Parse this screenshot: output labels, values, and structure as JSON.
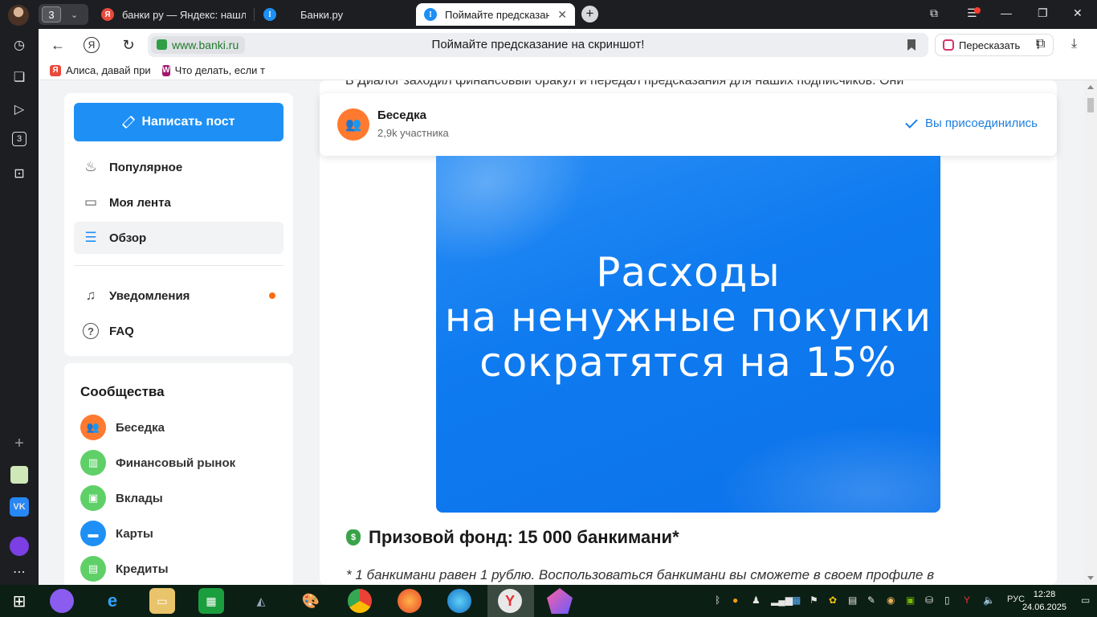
{
  "browser": {
    "tab_count": "3",
    "tabs": [
      {
        "label": "банки ру — Яндекс: нашл",
        "fav_color": "#e84a3c",
        "fav_glyph": "Я"
      },
      {
        "label": "Банки.ру",
        "fav_color": "#1e90f5",
        "fav_glyph": "⁝"
      },
      {
        "label": "Поймайте предсказани",
        "fav_color": "#1e90f5",
        "fav_glyph": "⁝"
      }
    ],
    "domain": "www.banki.ru",
    "page_title": "Поймайте предсказание на скриншот!",
    "retell_label": "Пересказать",
    "bookmarks": [
      {
        "label": "Алиса, давай при",
        "icon_color": "#e84a3c",
        "glyph": "Я"
      },
      {
        "label": "Что делать, если т",
        "icon_color": "#a3166e",
        "glyph": "W"
      }
    ],
    "rail_tab_count": "3"
  },
  "sidebar": {
    "write_post_label": "Написать пост",
    "nav": [
      {
        "label": "Популярное",
        "icon": "flame-icon",
        "glyph": "♨"
      },
      {
        "label": "Моя лента",
        "icon": "feed-icon",
        "glyph": "▭"
      },
      {
        "label": "Обзор",
        "icon": "explore-icon",
        "glyph": "☰"
      },
      {
        "label": "Уведомления",
        "icon": "bell-icon",
        "glyph": "🔔"
      },
      {
        "label": "FAQ",
        "icon": "question-icon",
        "glyph": "?"
      }
    ],
    "communities_title": "Сообщества",
    "communities": [
      {
        "label": "Беседка",
        "color": "#ff7a2f",
        "glyph": "👥"
      },
      {
        "label": "Финансовый рынок",
        "color": "#5fd068",
        "glyph": "▥"
      },
      {
        "label": "Вклады",
        "color": "#5fd068",
        "glyph": "▣"
      },
      {
        "label": "Карты",
        "color": "#1e90f5",
        "glyph": "▬"
      },
      {
        "label": "Кредиты",
        "color": "#5fd068",
        "glyph": "▤"
      }
    ]
  },
  "post": {
    "intro": "В Диалог заходил финансовый оракул и передал предсказания для наших подписчиков. Они",
    "community": {
      "name": "Беседка",
      "members": "2,9k участника",
      "joined_label": "Вы присоединились"
    },
    "banner_lines": [
      "Расходы",
      "на ненужные покупки",
      "сократятся на 15%"
    ],
    "prize_heading": "Призовой фонд: 15 000 банкимани*",
    "footnote": "* 1 банкимани равен 1 рублю. Воспользоваться банкимани вы сможете в своем профиле в"
  },
  "taskbar": {
    "language": "РУС",
    "time": "12:28",
    "date": "24.06.2025"
  },
  "colors": {
    "accent": "#1e90f5",
    "banner": "#0f7bf0",
    "notify": "#ff6a13",
    "joined": "#1e7fe0"
  }
}
